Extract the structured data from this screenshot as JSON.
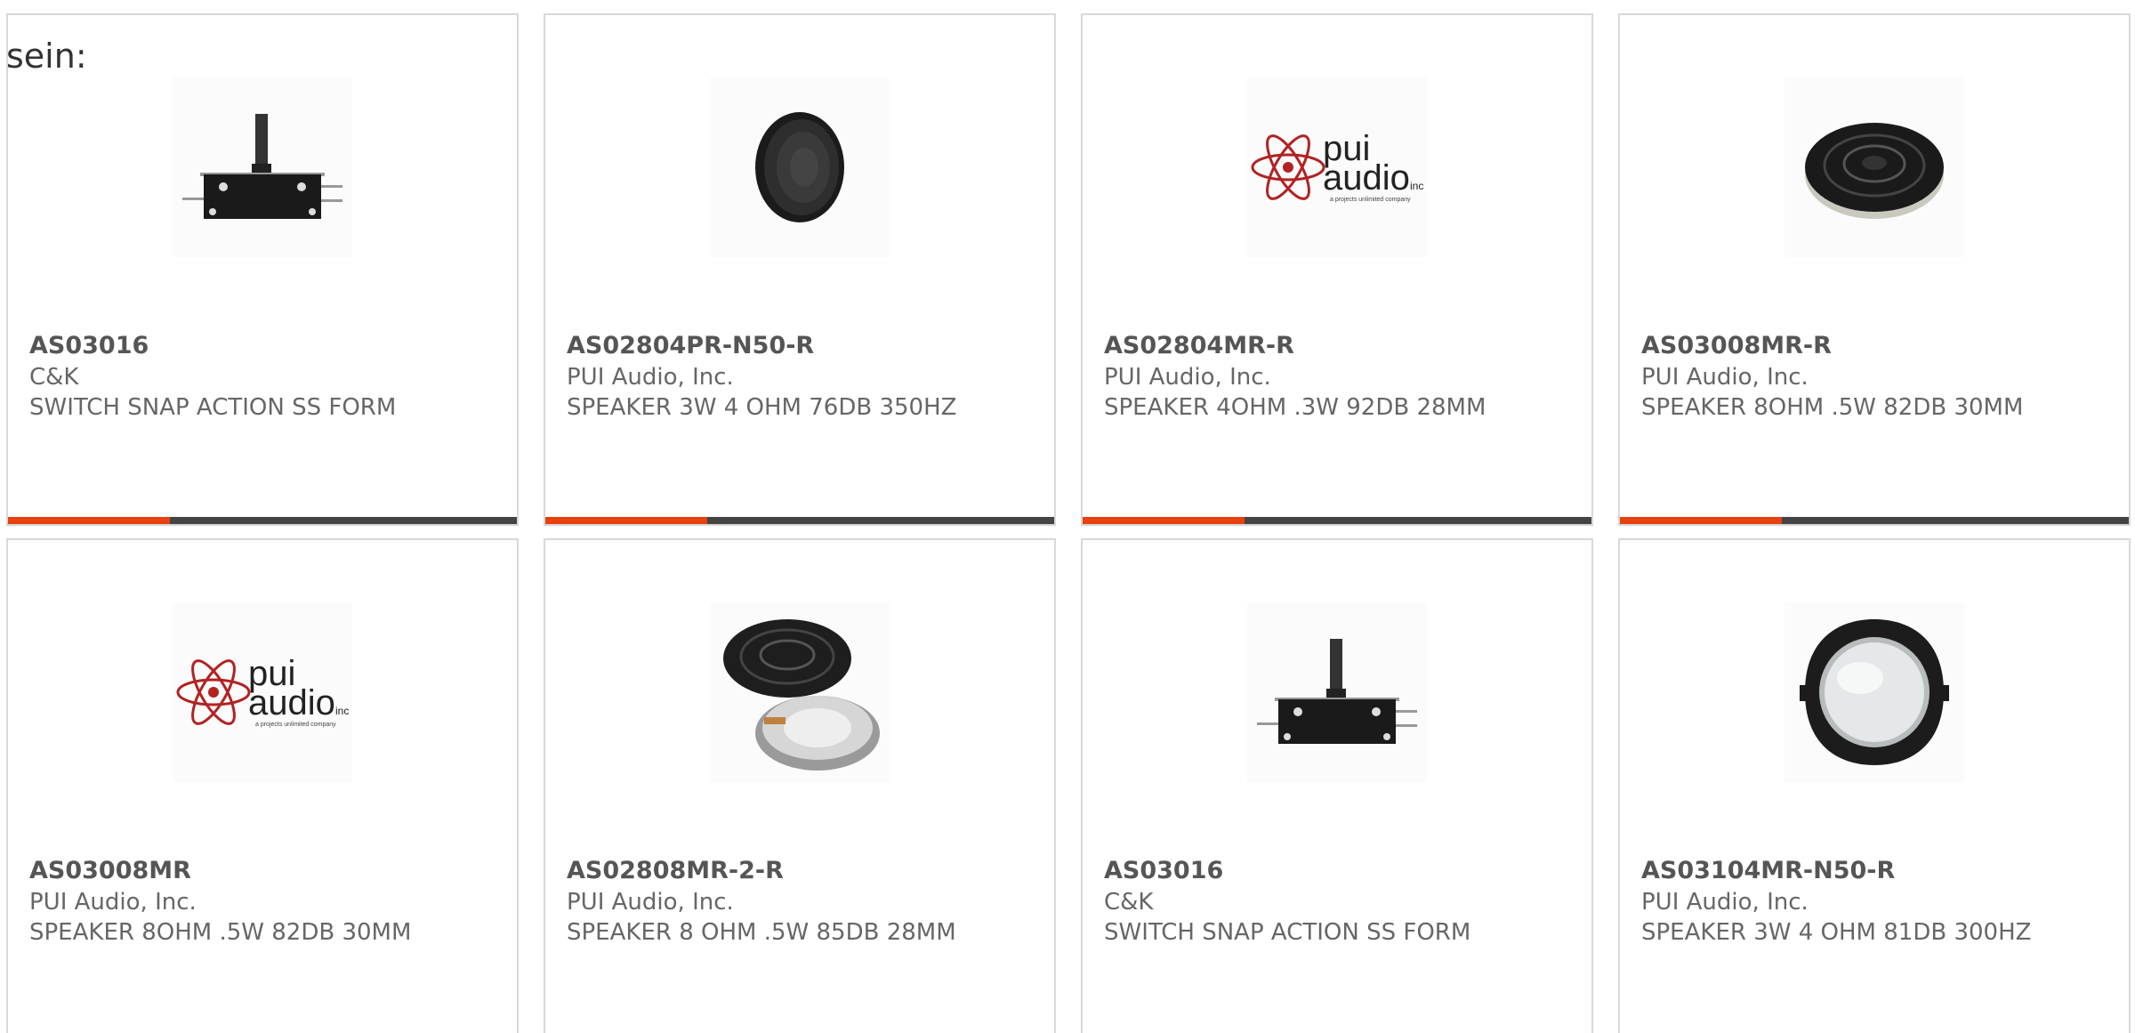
{
  "heading": "sein:",
  "colors": {
    "accent": "#e8410f",
    "bar": "#444444",
    "border": "#d8d8d8",
    "text": "#666666"
  },
  "products": [
    {
      "part": "AS03016",
      "manufacturer": "C&K",
      "description": "SWITCH SNAP ACTION SS FORM",
      "image_icon": "snap-switch-image"
    },
    {
      "part": "AS02804PR-N50-R",
      "manufacturer": "PUI Audio, Inc.",
      "description": "SPEAKER 3W 4 OHM 76DB 350HZ",
      "image_icon": "speaker-image"
    },
    {
      "part": "AS02804MR-R",
      "manufacturer": "PUI Audio, Inc.",
      "description": "SPEAKER 4OHM .3W 92DB 28MM",
      "image_icon": "pui-audio-logo",
      "logo": {
        "line1": "pui",
        "line2": "audio",
        "suffix": "inc",
        "tagline": "a projects unlimited company"
      }
    },
    {
      "part": "AS03008MR-R",
      "manufacturer": "PUI Audio, Inc.",
      "description": "SPEAKER 8OHM .5W 82DB 30MM",
      "image_icon": "speaker-flat-image"
    },
    {
      "part": "AS03008MR",
      "manufacturer": "PUI Audio, Inc.",
      "description": "SPEAKER 8OHM .5W 82DB 30MM",
      "image_icon": "pui-audio-logo",
      "logo": {
        "line1": "pui",
        "line2": "audio",
        "suffix": "inc",
        "tagline": "a projects unlimited company"
      }
    },
    {
      "part": "AS02808MR-2-R",
      "manufacturer": "PUI Audio, Inc.",
      "description": "SPEAKER 8 OHM .5W 85DB 28MM",
      "image_icon": "speaker-pair-image"
    },
    {
      "part": "AS03016",
      "manufacturer": "C&K",
      "description": "SWITCH SNAP ACTION SS FORM",
      "image_icon": "snap-switch-image"
    },
    {
      "part": "AS03104MR-N50-R",
      "manufacturer": "PUI Audio, Inc.",
      "description": "SPEAKER 3W 4 OHM 81DB 300HZ",
      "image_icon": "speaker-silver-image"
    }
  ]
}
